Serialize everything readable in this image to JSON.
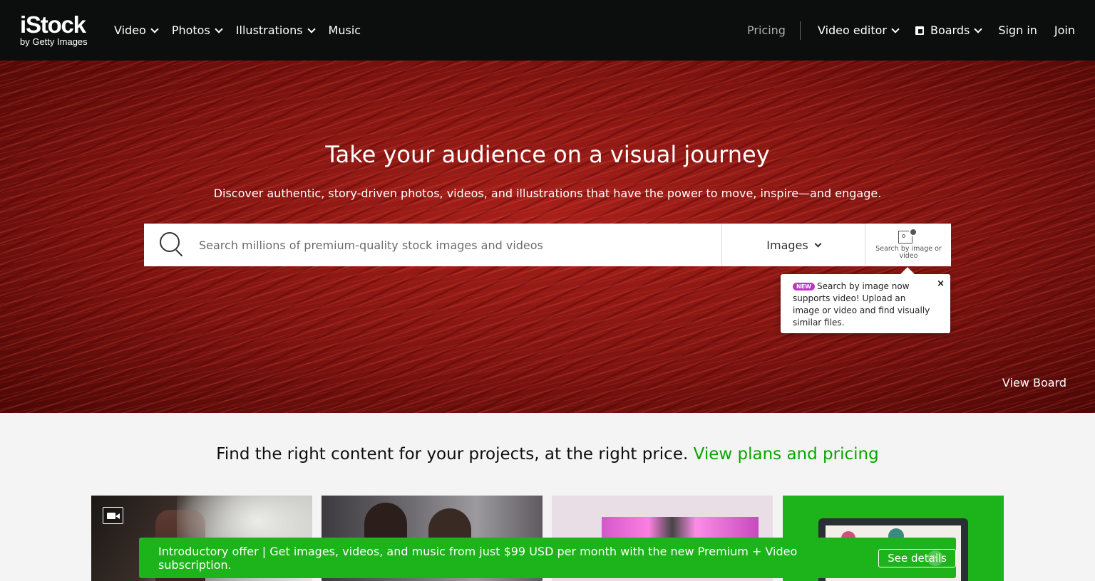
{
  "header": {
    "logo_main": "iStock",
    "logo_sub": "by Getty Images",
    "nav_left": [
      {
        "label": "Video",
        "has_dropdown": true
      },
      {
        "label": "Photos",
        "has_dropdown": true
      },
      {
        "label": "Illustrations",
        "has_dropdown": true
      },
      {
        "label": "Music",
        "has_dropdown": false
      }
    ],
    "pricing": "Pricing",
    "video_editor": "Video editor",
    "boards": "Boards",
    "sign_in": "Sign in",
    "join": "Join"
  },
  "hero": {
    "title": "Take your audience on a visual journey",
    "subtitle": "Discover authentic, story-driven photos, videos, and illustrations that have the power to move, inspire—and engage.",
    "search": {
      "placeholder": "Search millions of premium-quality stock images and videos",
      "value": "",
      "type_selected": "Images",
      "image_search_label": "Search by image or video"
    },
    "tooltip": {
      "badge": "NEW",
      "text": "Search by image now supports video! Upload an image or video and find visually similar files.",
      "close": "×"
    },
    "view_board": "View Board"
  },
  "promo": {
    "text": "Find the right content for your projects, at the right price.",
    "link": "View plans and pricing"
  },
  "offer_bar": {
    "text": "Introductory offer | Get images, videos, and music from just $99 USD per month with the new Premium + Video subscription.",
    "button": "See details",
    "close": "×"
  },
  "colors": {
    "header_bg": "#0c0d0d",
    "accent_green": "#08a500",
    "offer_green": "#1db31b",
    "badge_pink": "#c133c8"
  },
  "icons": [
    "search-icon",
    "chevron-down-icon",
    "boards-icon",
    "image-search-icon",
    "close-icon",
    "video-camera-icon"
  ]
}
